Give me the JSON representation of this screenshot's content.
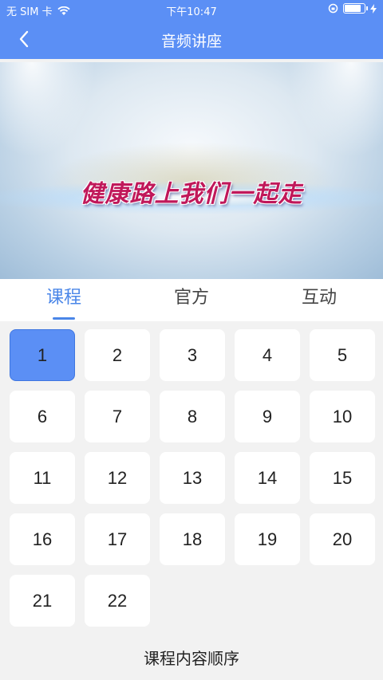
{
  "status_bar": {
    "carrier": "无 SIM 卡",
    "time": "下午10:47",
    "battery_level": 0.9
  },
  "header": {
    "title": "音频讲座",
    "back_icon": "chevron-left-icon"
  },
  "banner": {
    "text": "健康路上我们一起走"
  },
  "tabs": [
    {
      "label": "课程",
      "active": true
    },
    {
      "label": "官方",
      "active": false
    },
    {
      "label": "互动",
      "active": false
    }
  ],
  "lessons": [
    "1",
    "2",
    "3",
    "4",
    "5",
    "6",
    "7",
    "8",
    "9",
    "10",
    "11",
    "12",
    "13",
    "14",
    "15",
    "16",
    "17",
    "18",
    "19",
    "20",
    "21",
    "22"
  ],
  "selected_lesson": "1",
  "footer": {
    "label": "课程内容顺序"
  },
  "colors": {
    "accent": "#5b8ff5",
    "active_tab": "#4a86e8",
    "banner_text": "#c0185a"
  }
}
